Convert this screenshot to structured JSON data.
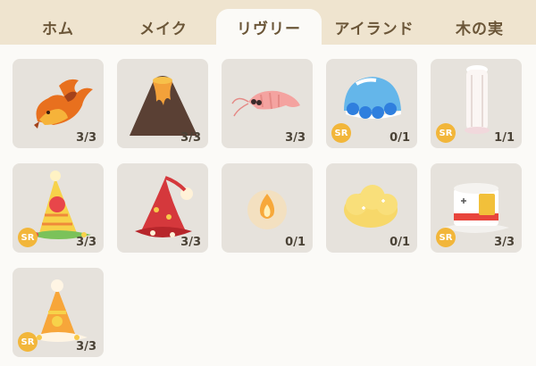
{
  "tabs": [
    {
      "label": "ホム"
    },
    {
      "label": "メイク"
    },
    {
      "label": "リヴリー",
      "active": true
    },
    {
      "label": "アイランド"
    },
    {
      "label": "木の実"
    }
  ],
  "items": [
    {
      "icon": "fire-fox-icon",
      "count": "3/3",
      "sr": false
    },
    {
      "icon": "volcano-icon",
      "count": "3/3",
      "sr": false
    },
    {
      "icon": "shrimp-icon",
      "count": "3/3",
      "sr": false,
      "highlight": true
    },
    {
      "icon": "blue-flower-hat-icon",
      "count": "0/1",
      "sr": true,
      "sr_label": "SR"
    },
    {
      "icon": "chef-hat-icon",
      "count": "1/1",
      "sr": true,
      "sr_label": "SR"
    },
    {
      "icon": "birthday-hat-4-icon",
      "count": "3/3",
      "sr": true,
      "sr_label": "SR"
    },
    {
      "icon": "red-wizard-hat-icon",
      "count": "3/3",
      "sr": false
    },
    {
      "icon": "flame-wisp-icon",
      "count": "0/1",
      "sr": false
    },
    {
      "icon": "yellow-cloud-icon",
      "count": "0/1",
      "sr": false
    },
    {
      "icon": "white-top-hat-icon",
      "count": "3/3",
      "sr": true,
      "sr_label": "SR"
    },
    {
      "icon": "orange-party-hat-icon",
      "count": "3/3",
      "sr": true,
      "sr_label": "SR"
    }
  ]
}
